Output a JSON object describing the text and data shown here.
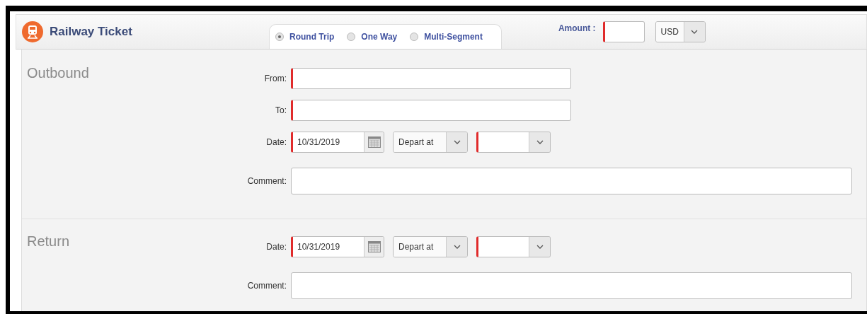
{
  "header": {
    "title": "Railway Ticket",
    "trip_types": [
      {
        "label": "Round Trip",
        "selected": true
      },
      {
        "label": "One Way",
        "selected": false
      },
      {
        "label": "Multi-Segment",
        "selected": false
      }
    ],
    "amount": {
      "label": "Amount :",
      "required": true
    },
    "currency": {
      "value": "USD"
    }
  },
  "sections": [
    {
      "title": "Outbound",
      "fields": [
        {
          "kind": "text",
          "label": "From:",
          "required": true
        },
        {
          "kind": "text",
          "label": "To:",
          "required": true
        },
        {
          "kind": "datetime",
          "label": "Date:",
          "date": {
            "value": "10/31/2019",
            "required": true
          },
          "mode": {
            "value": "Depart at"
          },
          "time": {
            "required": true
          }
        },
        {
          "kind": "comment",
          "label": "Comment:"
        }
      ]
    },
    {
      "title": "Return",
      "fields": [
        {
          "kind": "datetime",
          "label": "Date:",
          "date": {
            "value": "10/31/2019",
            "required": true
          },
          "mode": {
            "value": "Depart at"
          },
          "time": {
            "required": true
          }
        },
        {
          "kind": "comment",
          "label": "Comment:"
        }
      ]
    }
  ]
}
